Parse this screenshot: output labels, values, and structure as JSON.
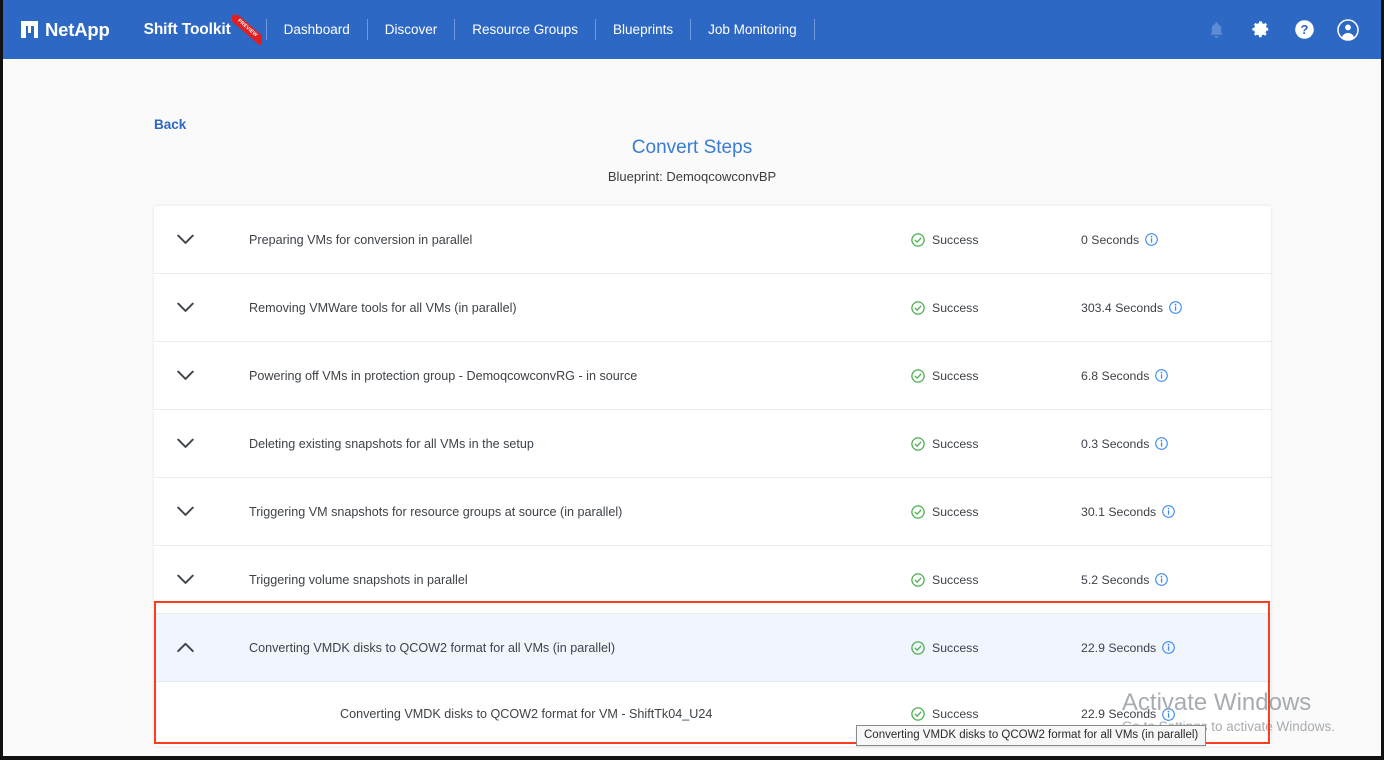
{
  "brand": {
    "company": "NetApp",
    "product": "Shift Toolkit",
    "ribbon_label": "PREVIEW",
    "accent_color": "#2d68c4",
    "ribbon_color": "#e02020"
  },
  "nav": {
    "items": [
      {
        "label": "Dashboard",
        "name": "nav-item-dashboard"
      },
      {
        "label": "Discover",
        "name": "nav-item-discover"
      },
      {
        "label": "Resource Groups",
        "name": "nav-item-resource-groups"
      },
      {
        "label": "Blueprints",
        "name": "nav-item-blueprints"
      },
      {
        "label": "Job Monitoring",
        "name": "nav-item-job-monitoring"
      }
    ],
    "icons": [
      "bell-icon",
      "gear-icon",
      "help-icon",
      "user-account-icon"
    ]
  },
  "page": {
    "back_label": "Back",
    "title": "Convert Steps",
    "subtitle": "Blueprint: DemoqcowconvBP",
    "title_color": "#3a7bd5"
  },
  "steps": [
    {
      "label": "Preparing VMs for conversion in parallel",
      "status": "Success",
      "duration": "0 Seconds",
      "expanded": false
    },
    {
      "label": "Removing VMWare tools for all VMs (in parallel)",
      "status": "Success",
      "duration": "303.4 Seconds",
      "expanded": false
    },
    {
      "label": "Powering off VMs in protection group - DemoqcowconvRG - in source",
      "status": "Success",
      "duration": "6.8 Seconds",
      "expanded": false
    },
    {
      "label": "Deleting existing snapshots for all VMs in the setup",
      "status": "Success",
      "duration": "0.3 Seconds",
      "expanded": false
    },
    {
      "label": "Triggering VM snapshots for resource groups at source (in parallel)",
      "status": "Success",
      "duration": "30.1 Seconds",
      "expanded": false
    },
    {
      "label": "Triggering volume snapshots in parallel",
      "status": "Success",
      "duration": "5.2 Seconds",
      "expanded": false
    },
    {
      "label": "Converting VMDK disks to QCOW2 format for all VMs (in parallel)",
      "status": "Success",
      "duration": "22.9 Seconds",
      "expanded": true
    }
  ],
  "substeps": [
    {
      "label": "Converting VMDK disks to QCOW2 format for VM - ShiftTk04_U24",
      "status": "Success",
      "duration": "22.9 Seconds"
    }
  ],
  "tooltip": {
    "text": "Converting VMDK disks to QCOW2 format for all VMs (in parallel)"
  },
  "annotation": {
    "color": "#ff3b1f"
  },
  "watermark": {
    "title": "Activate Windows",
    "subtitle": "Go to Settings to activate Windows."
  },
  "status_colors": {
    "success": "#4caf50",
    "info": "#3c8cf0"
  }
}
